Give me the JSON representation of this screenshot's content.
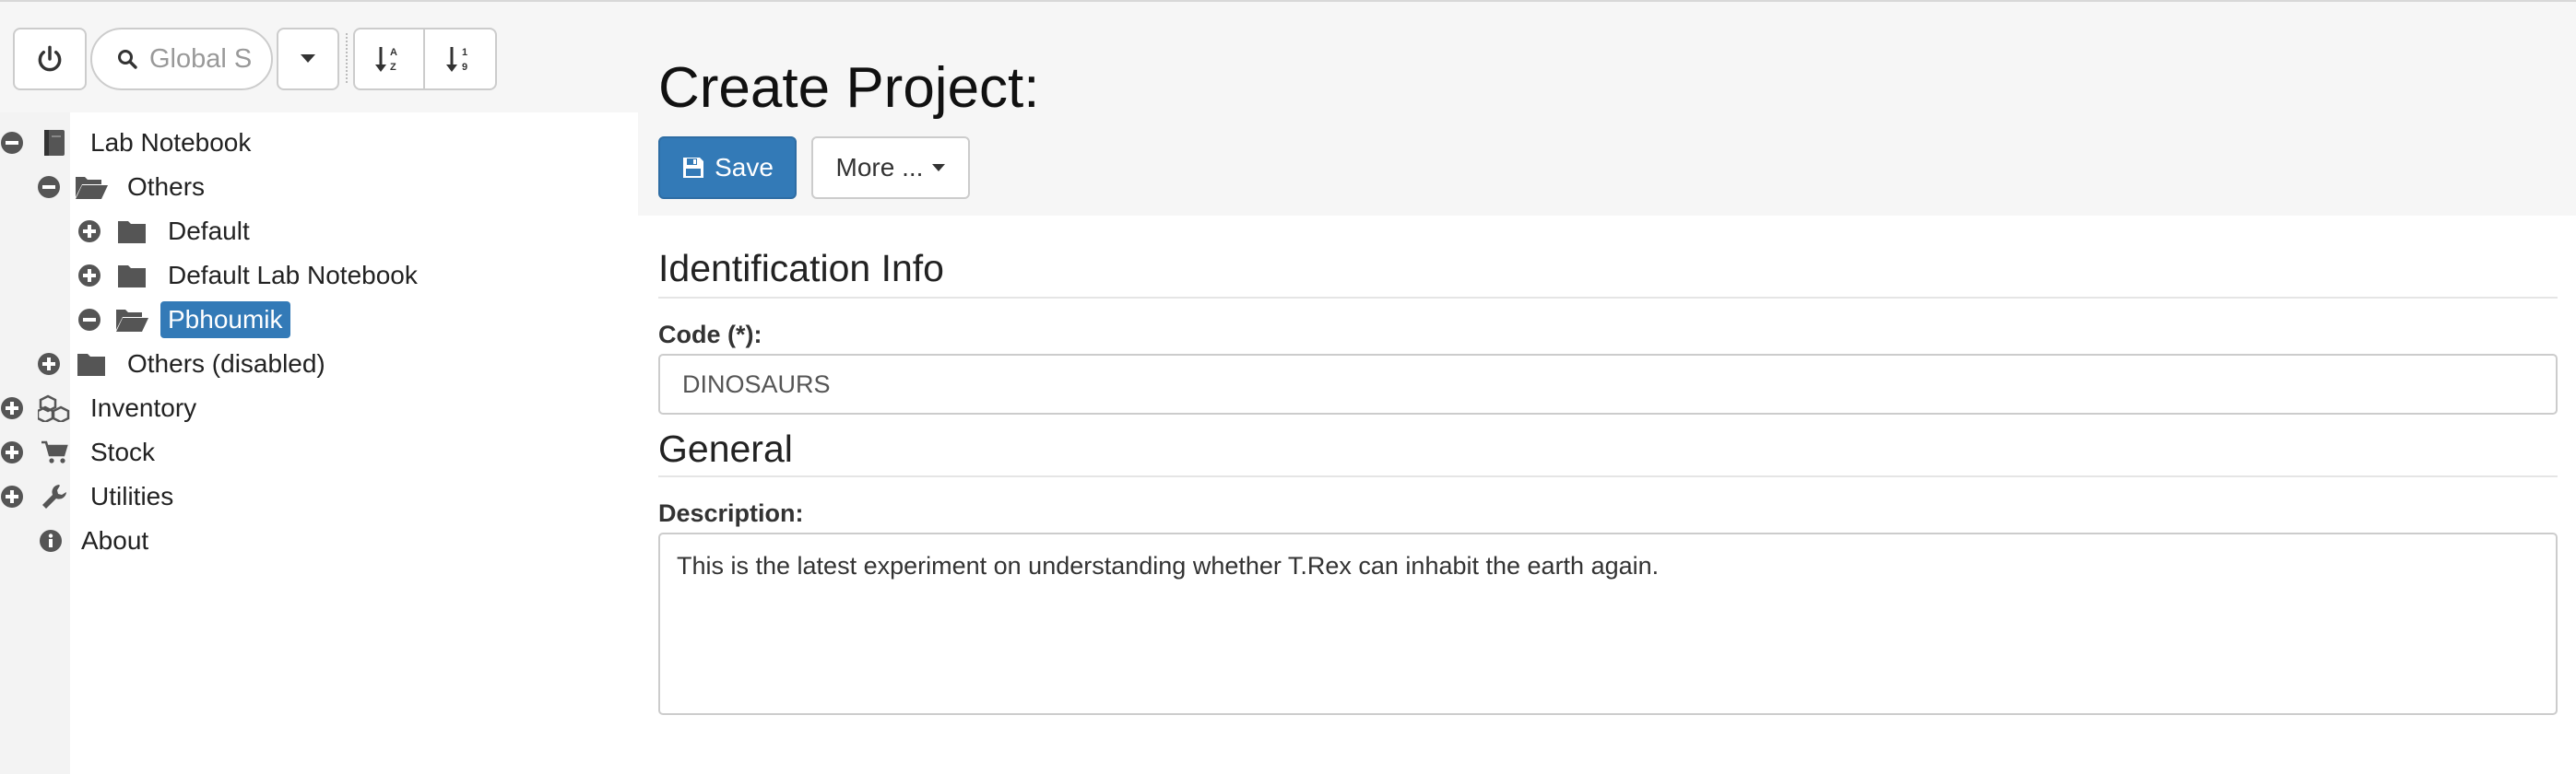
{
  "toolbar": {
    "search_placeholder": "Global Search",
    "icons": [
      "power-icon",
      "search-icon",
      "caret-down-icon",
      "sort-alpha-icon",
      "sort-numeric-icon"
    ]
  },
  "tree": {
    "nodes": [
      {
        "label": "Lab Notebook",
        "icon": "book-icon",
        "toggle": "minus"
      },
      {
        "label": "Others",
        "icon": "folder-open-icon",
        "toggle": "minus"
      },
      {
        "label": "Default",
        "icon": "folder-icon",
        "toggle": "plus"
      },
      {
        "label": "Default Lab Notebook",
        "icon": "folder-icon",
        "toggle": "plus"
      },
      {
        "label": "Pbhoumik",
        "icon": "folder-open-icon",
        "toggle": "minus",
        "selected": true
      },
      {
        "label": "Others (disabled)",
        "icon": "folder-icon",
        "toggle": "plus"
      },
      {
        "label": "Inventory",
        "icon": "cubes-icon",
        "toggle": "plus"
      },
      {
        "label": "Stock",
        "icon": "cart-icon",
        "toggle": "plus"
      },
      {
        "label": "Utilities",
        "icon": "wrench-icon",
        "toggle": "plus"
      },
      {
        "label": "About",
        "icon": "info-icon",
        "toggle": "none"
      }
    ]
  },
  "main": {
    "title": "Create Project:",
    "save_label": "Save",
    "more_label": "More ...",
    "sections": {
      "identification": "Identification Info",
      "general": "General"
    },
    "fields": {
      "code_label": "Code (*):",
      "code_value": "DINOSAURS",
      "description_label": "Description:",
      "description_value": "This is the latest experiment on understanding whether T.Rex can inhabit the earth again."
    }
  },
  "colors": {
    "primary": "#337ab7",
    "header_bg": "#f6f6f6",
    "border": "#cccccc",
    "icon": "#555555"
  }
}
